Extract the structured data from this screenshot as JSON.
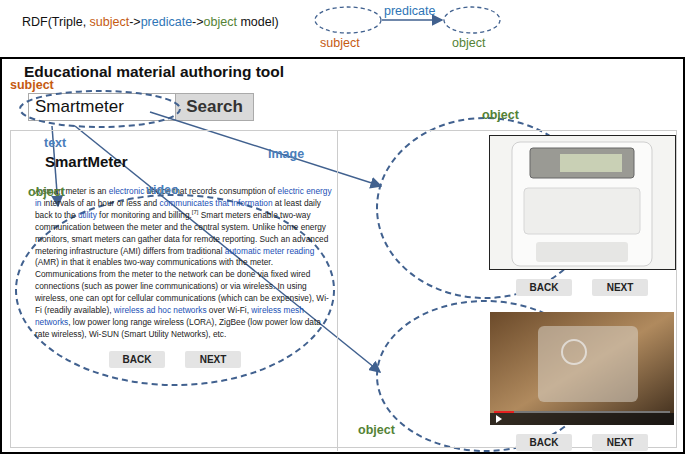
{
  "header": {
    "segments": [
      {
        "text": "RDF(Triple, ",
        "color": "#111111"
      },
      {
        "text": "subject",
        "color": "#c55a11"
      },
      {
        "text": "->",
        "color": "#111111"
      },
      {
        "text": "predicate",
        "color": "#2e75b6"
      },
      {
        "text": "->",
        "color": "#111111"
      },
      {
        "text": "object",
        "color": "#548235"
      },
      {
        "text": " model)",
        "color": "#111111"
      }
    ]
  },
  "legend": {
    "subject": "subject",
    "predicate": "predicate",
    "object": "object"
  },
  "tool": {
    "title": "Educational material authoring tool",
    "search": {
      "value": "Smartmeter",
      "button": "Search"
    }
  },
  "article": {
    "title": "SmartMeter",
    "segments": [
      {
        "text": "A smart meter is an ",
        "kind": "text"
      },
      {
        "text": "electronic",
        "kind": "link"
      },
      {
        "text": " device that records consumption of ",
        "kind": "text"
      },
      {
        "text": "electric energy in",
        "kind": "link"
      },
      {
        "text": " intervals of an hour or less and ",
        "kind": "text"
      },
      {
        "text": "communicates that information",
        "kind": "link"
      },
      {
        "text": " at least daily back to the ",
        "kind": "text"
      },
      {
        "text": "utility",
        "kind": "link"
      },
      {
        "text": " for monitoring and billing.",
        "kind": "text"
      },
      {
        "text": "[7]",
        "kind": "sup"
      },
      {
        "text": " Smart meters enable two-way communication between the meter and the central system. Unlike home energy monitors, smart meters can gather data for remote reporting. Such an advanced metering infrastructure (AMI) differs from traditional ",
        "kind": "text"
      },
      {
        "text": "automatic meter reading",
        "kind": "link"
      },
      {
        "text": " (AMR) in that it enables two-way communications with the meter. Communications from the meter to the network can be done via fixed wired connections (such as power line communications) or via wireless. In using wireless, one can opt for cellular communications (which can be expensive), Wi-Fi (readily available), ",
        "kind": "text"
      },
      {
        "text": "wireless ad hoc networks",
        "kind": "link"
      },
      {
        "text": " over Wi-Fi, ",
        "kind": "text"
      },
      {
        "text": "wireless mesh networks",
        "kind": "link"
      },
      {
        "text": ", low power long range wireless (LORA), ZigBee (low power low data rate wireless), Wi-SUN (Smart Utility Networks), etc.",
        "kind": "text"
      }
    ],
    "buttons": [
      "BACK",
      "NEXT"
    ]
  },
  "image_panel": {
    "buttons": [
      "BACK",
      "NEXT"
    ]
  },
  "video_panel": {
    "buttons": [
      "BACK",
      "NEXT"
    ]
  },
  "annotations": [
    {
      "text": "subject",
      "color": "#c55a11"
    },
    {
      "text": "text",
      "color": "#4a7ebb"
    },
    {
      "text": "image",
      "color": "#4a7ebb"
    },
    {
      "text": "video",
      "color": "#4a7ebb"
    },
    {
      "text": "object",
      "color": "#548235"
    },
    {
      "text": "object",
      "color": "#548235"
    },
    {
      "text": "object",
      "color": "#548235"
    }
  ]
}
